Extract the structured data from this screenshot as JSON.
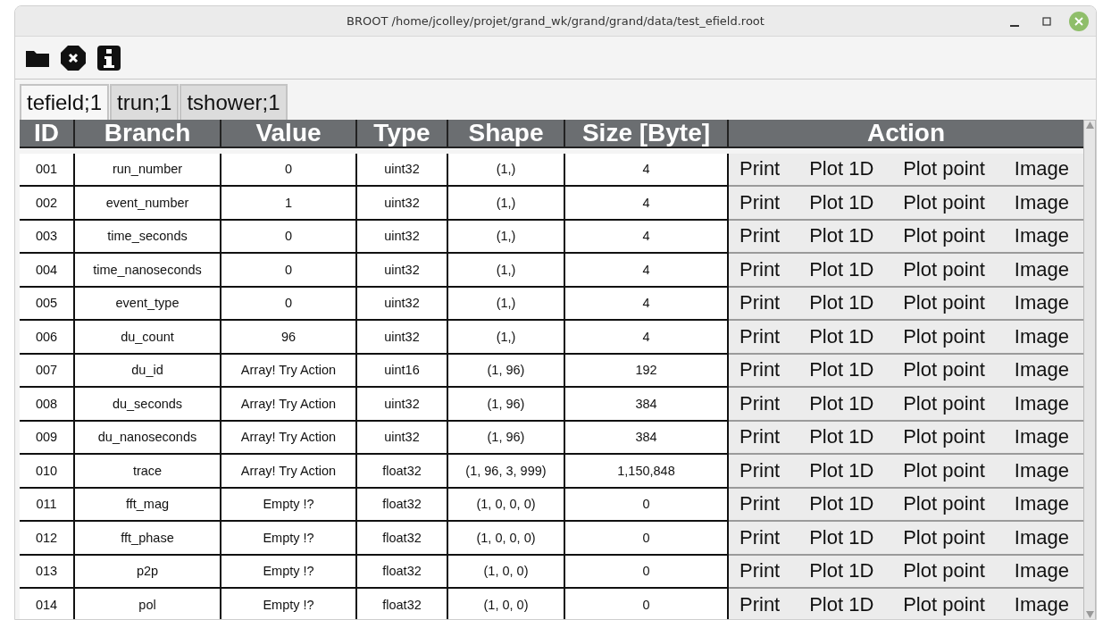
{
  "window": {
    "title": "BROOT /home/jcolley/projet/grand_wk/grand/grand/data/test_efield.root"
  },
  "tabs": [
    {
      "label": "tefield;1",
      "selected": true
    },
    {
      "label": "trun;1",
      "selected": false
    },
    {
      "label": "tshower;1",
      "selected": false
    }
  ],
  "table": {
    "columns": [
      "ID",
      "Branch",
      "Value",
      "Type",
      "Shape",
      "Size [Byte]",
      "Action"
    ],
    "rows": [
      {
        "cells": [
          "001",
          "run_number",
          "0",
          "uint32",
          "(1,)",
          "4"
        ],
        "actions": [
          "Print",
          "Plot 1D",
          "Plot point",
          "Image"
        ]
      },
      {
        "cells": [
          "002",
          "event_number",
          "1",
          "uint32",
          "(1,)",
          "4"
        ],
        "actions": [
          "Print",
          "Plot 1D",
          "Plot point",
          "Image"
        ]
      },
      {
        "cells": [
          "003",
          "time_seconds",
          "0",
          "uint32",
          "(1,)",
          "4"
        ],
        "actions": [
          "Print",
          "Plot 1D",
          "Plot point",
          "Image"
        ]
      },
      {
        "cells": [
          "004",
          "time_nanoseconds",
          "0",
          "uint32",
          "(1,)",
          "4"
        ],
        "actions": [
          "Print",
          "Plot 1D",
          "Plot point",
          "Image"
        ]
      },
      {
        "cells": [
          "005",
          "event_type",
          "0",
          "uint32",
          "(1,)",
          "4"
        ],
        "actions": [
          "Print",
          "Plot 1D",
          "Plot point",
          "Image"
        ]
      },
      {
        "cells": [
          "006",
          "du_count",
          "96",
          "uint32",
          "(1,)",
          "4"
        ],
        "actions": [
          "Print",
          "Plot 1D",
          "Plot point",
          "Image"
        ]
      },
      {
        "cells": [
          "007",
          "du_id",
          "Array! Try Action",
          "uint16",
          "(1, 96)",
          "192"
        ],
        "actions": [
          "Print",
          "Plot 1D",
          "Plot point",
          "Image"
        ]
      },
      {
        "cells": [
          "008",
          "du_seconds",
          "Array! Try Action",
          "uint32",
          "(1, 96)",
          "384"
        ],
        "actions": [
          "Print",
          "Plot 1D",
          "Plot point",
          "Image"
        ]
      },
      {
        "cells": [
          "009",
          "du_nanoseconds",
          "Array! Try Action",
          "uint32",
          "(1, 96)",
          "384"
        ],
        "actions": [
          "Print",
          "Plot 1D",
          "Plot point",
          "Image"
        ]
      },
      {
        "cells": [
          "010",
          "trace",
          "Array! Try Action",
          "float32",
          "(1, 96, 3, 999)",
          "1,150,848"
        ],
        "actions": [
          "Print",
          "Plot 1D",
          "Plot point",
          "Image"
        ]
      },
      {
        "cells": [
          "011",
          "fft_mag",
          "Empty !?",
          "float32",
          "(1, 0, 0, 0)",
          "0"
        ],
        "actions": [
          "Print",
          "Plot 1D",
          "Plot point",
          "Image"
        ]
      },
      {
        "cells": [
          "012",
          "fft_phase",
          "Empty !?",
          "float32",
          "(1, 0, 0, 0)",
          "0"
        ],
        "actions": [
          "Print",
          "Plot 1D",
          "Plot point",
          "Image"
        ]
      },
      {
        "cells": [
          "013",
          "p2p",
          "Empty !?",
          "float32",
          "(1, 0, 0)",
          "0"
        ],
        "actions": [
          "Print",
          "Plot 1D",
          "Plot point",
          "Image"
        ]
      },
      {
        "cells": [
          "014",
          "pol",
          "Empty !?",
          "float32",
          "(1, 0, 0)",
          "0"
        ],
        "actions": [
          "Print",
          "Plot 1D",
          "Plot point",
          "Image"
        ]
      }
    ]
  }
}
